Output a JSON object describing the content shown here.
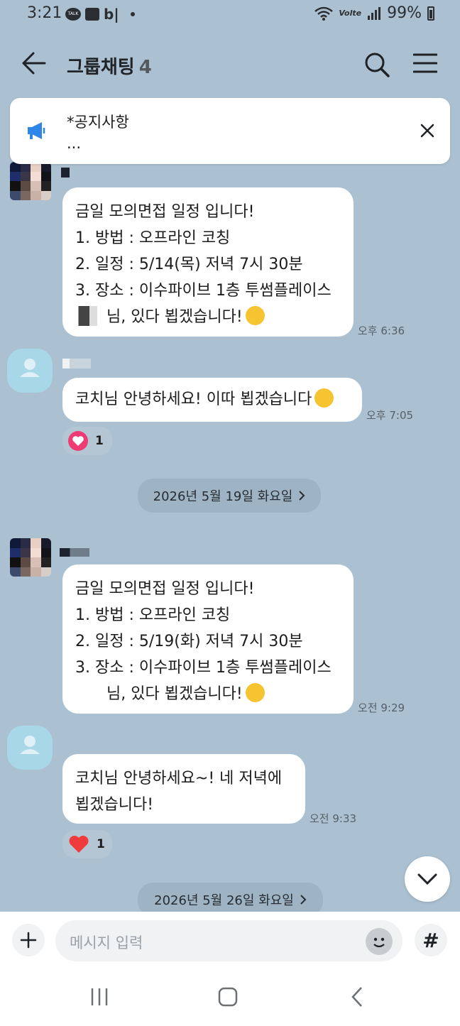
{
  "status_bar": {
    "time": "3:21",
    "app_icons": [
      "talk-icon",
      "gallery-icon",
      "b-icon",
      "dot-icon"
    ],
    "partial_app_text": "b|",
    "network": "Volte",
    "battery": "99%"
  },
  "header": {
    "title": "그룹채팅",
    "member_count": "4"
  },
  "notice": {
    "title": "*공지사항",
    "subtitle": "..."
  },
  "messages": [
    {
      "lines": [
        "금일 모의면접 일정 입니다!",
        "1. 방법 : 오프라인 코칭",
        "2. 일정 : 5/14(목) 저녁 7시 30분",
        "3. 장소 : 이수파이브 1층 투썸플레이스"
      ],
      "last_line_suffix": "님, 있다 뵙겠습니다!",
      "time": "오후 6:36"
    },
    {
      "text": "코치님 안녕하세요! 이따 뵙겠습니다",
      "time": "오후 7:05",
      "reaction": {
        "icon": "heart-pink",
        "count": "1"
      }
    },
    {
      "lines": [
        "금일 모의면접 일정 입니다!",
        "1. 방법 : 오프라인 코칭",
        "2. 일정 : 5/19(화) 저녁 7시 30분",
        "3. 장소 : 이수파이브 1층 투썸플레이스"
      ],
      "last_line_suffix": "님, 있다 뵙겠습니다!",
      "time": "오전 9:29"
    },
    {
      "lines": [
        "코치님 안녕하세요~! 네 저녁에",
        "뵙겠습니다!"
      ],
      "time": "오전 9:33",
      "reaction": {
        "icon": "heart-red",
        "count": "1"
      }
    }
  ],
  "date_dividers": [
    "2026년 5월 19일 화요일",
    "2026년 5월 26일 화요일"
  ],
  "input": {
    "placeholder": "메시지 입력"
  },
  "colors": {
    "background": "#abc1d1",
    "bubble": "#ffffff",
    "notice_icon": "#2f86e8",
    "heart_pink": "#ee3b74",
    "heart_red": "#ef3b3b"
  }
}
